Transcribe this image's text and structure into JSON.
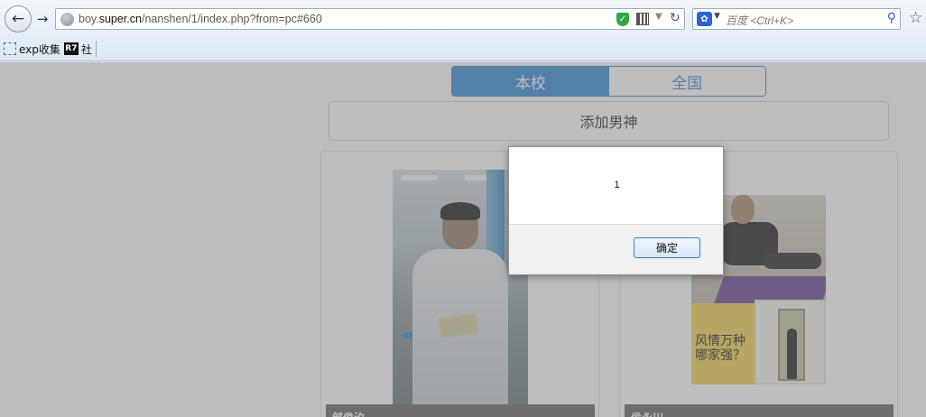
{
  "browser": {
    "back_icon": "arrow-left-icon",
    "forward_icon": "arrow-right-icon",
    "url_prefix": "boy.",
    "url_domain": "super.cn",
    "url_path": "/nanshen/1/index.php?from=pc#660",
    "search_placeholder": "百度 <Ctrl+K>",
    "bookmarks": [
      {
        "label": "exp收集",
        "icon": "dashed-square-icon"
      },
      {
        "label": "社",
        "icon": "r7-icon",
        "icon_text": "R7"
      }
    ]
  },
  "page": {
    "tabs": [
      {
        "label": "本校",
        "active": true
      },
      {
        "label": "全国",
        "active": false
      }
    ],
    "add_button_label": "添加男神",
    "cards": [
      {
        "name": "邹俊汐"
      },
      {
        "name": "侯永川",
        "image_text_line1": "风情万种",
        "image_text_line2": "哪家强？"
      }
    ]
  },
  "dialog": {
    "message": "1",
    "ok_label": "确定"
  },
  "colors": {
    "accent": "#3b8fd6",
    "overlay": "rgba(110,110,110,0.45)"
  }
}
